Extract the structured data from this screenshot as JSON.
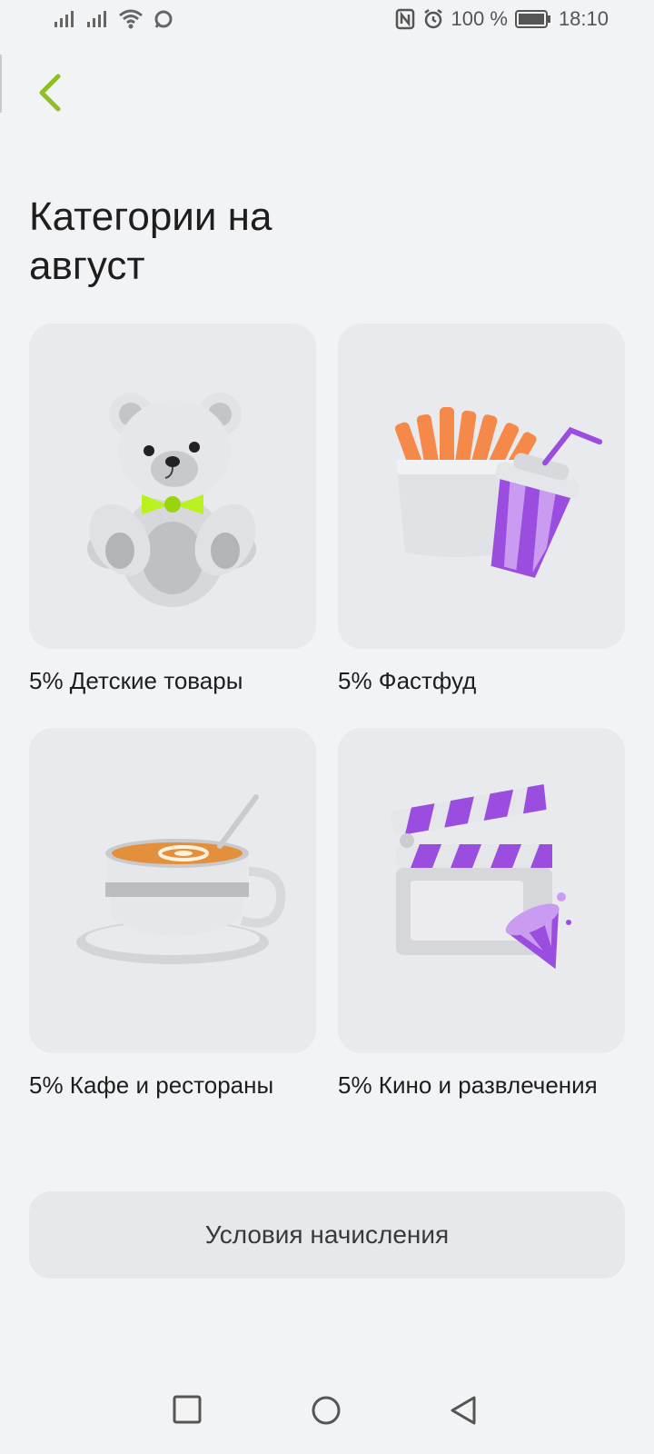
{
  "status_bar": {
    "battery_text": "100 %",
    "time": "18:10"
  },
  "header": {
    "title": "Категории на август"
  },
  "categories": [
    {
      "label": "5% Детские товары",
      "icon": "teddy-bear-icon"
    },
    {
      "label": "5% Фастфуд",
      "icon": "fastfood-icon"
    },
    {
      "label": "5% Кафе и рестораны",
      "icon": "coffee-cup-icon"
    },
    {
      "label": "5% Кино и развлечения",
      "icon": "clapperboard-icon"
    }
  ],
  "terms_button": {
    "label": "Условия начисления"
  },
  "colors": {
    "accent": "#8cc11f",
    "background": "#f2f3f5",
    "card": "#e9eaed",
    "purple": "#9b4de0"
  }
}
